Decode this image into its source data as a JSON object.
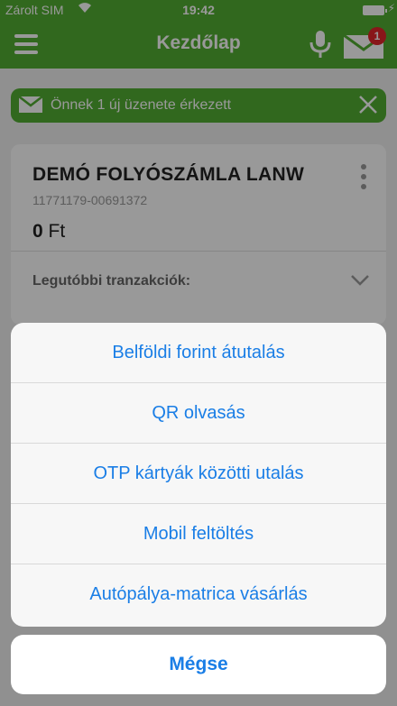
{
  "status_bar": {
    "carrier": "Zárolt SIM",
    "time": "19:42"
  },
  "nav": {
    "title": "Kezdőlap",
    "mail_badge": "1"
  },
  "notification": {
    "text": "Önnek 1 új üzenete érkezett"
  },
  "account": {
    "name": "DEMÓ FOLYÓSZÁMLA LANW",
    "number": "11771179-00691372",
    "balance_amount": "0",
    "balance_currency": "Ft",
    "transactions_label": "Legutóbbi tranzakciók:"
  },
  "action_sheet": {
    "items": [
      {
        "label": "Belföldi forint átutalás"
      },
      {
        "label": "QR olvasás"
      },
      {
        "label": "OTP kártyák közötti utalás"
      },
      {
        "label": "Mobil feltöltés"
      },
      {
        "label": "Autópálya-matrica vásárlás"
      }
    ],
    "cancel_label": "Mégse"
  },
  "colors": {
    "brand_green": "#52ae32",
    "action_blue": "#1a7ee6",
    "badge_red": "#e3262b"
  }
}
